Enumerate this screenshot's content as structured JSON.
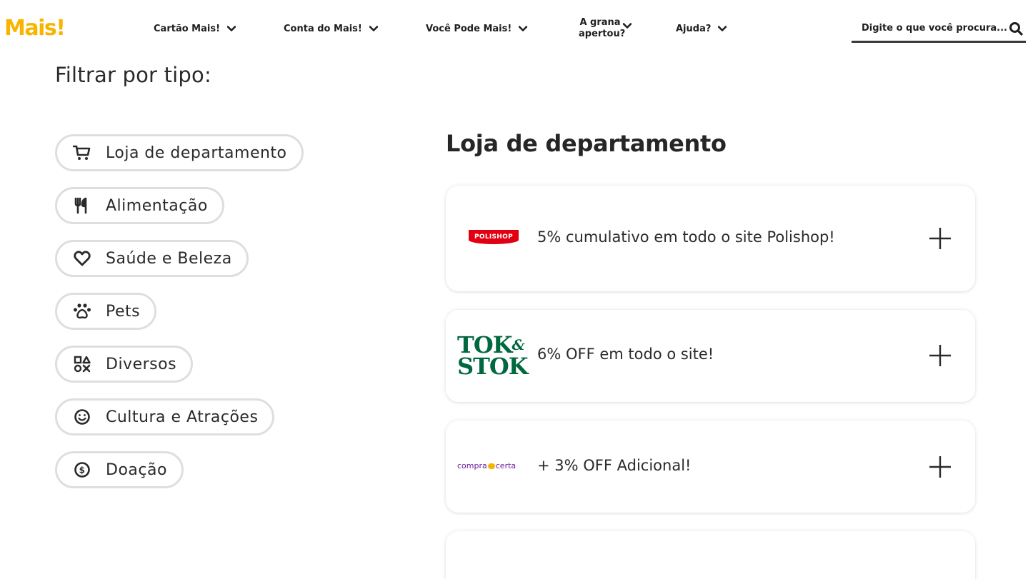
{
  "header": {
    "logo": "Mais!",
    "nav": [
      {
        "label": "Cartão Mais!"
      },
      {
        "label": "Conta do Mais!"
      },
      {
        "label": "Você Pode Mais!"
      },
      {
        "label": "A grana apertou?"
      },
      {
        "label": "Ajuda?"
      }
    ],
    "search_placeholder": "Digite o que você procura...",
    "colors": {
      "brand": "#f7b500"
    }
  },
  "filter": {
    "title": "Filtrar por tipo:",
    "items": [
      {
        "label": "Loja de departamento",
        "icon": "cart-icon"
      },
      {
        "label": "Alimentação",
        "icon": "fork-knife-icon"
      },
      {
        "label": "Saúde e Beleza",
        "icon": "heart-icon"
      },
      {
        "label": "Pets",
        "icon": "paw-icon"
      },
      {
        "label": "Diversos",
        "icon": "shapes-icon"
      },
      {
        "label": "Cultura e Atrações",
        "icon": "smiley-icon"
      },
      {
        "label": "Doação",
        "icon": "dollar-coin-icon"
      }
    ]
  },
  "section": {
    "title": "Loja de departamento",
    "offers": [
      {
        "brand": "POLISHOP",
        "text": "5% cumulativo em todo o site Polishop!",
        "brand_color": "#e10012"
      },
      {
        "brand": "TOK&STOK",
        "brand_line1": "TOK",
        "brand_amp": "&",
        "brand_line2": "STOK",
        "text": "6% OFF em todo o site!",
        "brand_color": "#00683f"
      },
      {
        "brand": "compra certa",
        "brand_part1": "compra",
        "brand_part2": "certa",
        "text": "+ 3% OFF Adicional!",
        "brand_color": "#6a1b9a"
      }
    ]
  }
}
